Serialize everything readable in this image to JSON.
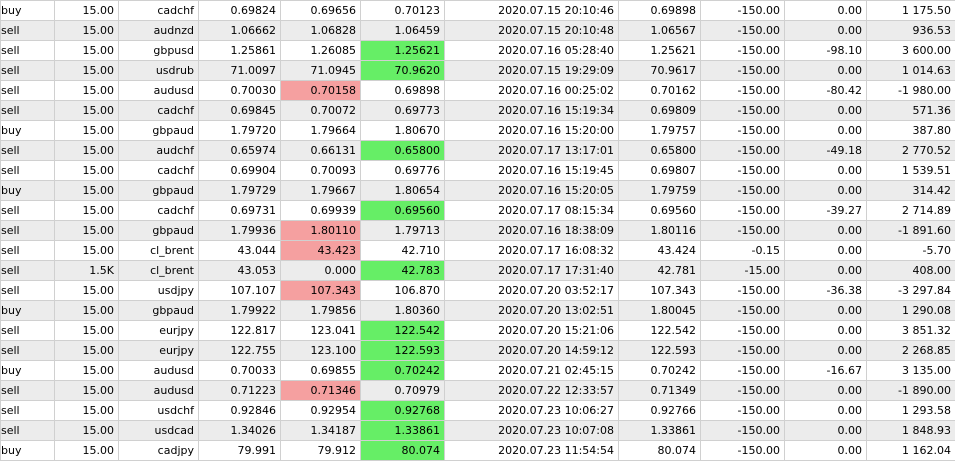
{
  "colors": {
    "tp_hit": "#66ee66",
    "sl_hit": "#f5a0a0",
    "row_alt": "#ececec"
  },
  "rows": [
    {
      "type": "buy",
      "volume": "15.00",
      "symbol": "cadchf",
      "open_price": "0.69824",
      "sl": "0.69656",
      "tp": "0.70123",
      "close_time": "2020.07.15 20:10:46",
      "close_price": "0.69898",
      "commission": "-150.00",
      "swap": "0.00",
      "profit": "1 175.50",
      "hit": ""
    },
    {
      "type": "sell",
      "volume": "15.00",
      "symbol": "audnzd",
      "open_price": "1.06662",
      "sl": "1.06828",
      "tp": "1.06459",
      "close_time": "2020.07.15 20:10:48",
      "close_price": "1.06567",
      "commission": "-150.00",
      "swap": "0.00",
      "profit": "936.53",
      "hit": ""
    },
    {
      "type": "sell",
      "volume": "15.00",
      "symbol": "gbpusd",
      "open_price": "1.25861",
      "sl": "1.26085",
      "tp": "1.25621",
      "close_time": "2020.07.16 05:28:40",
      "close_price": "1.25621",
      "commission": "-150.00",
      "swap": "-98.10",
      "profit": "3 600.00",
      "hit": "tp"
    },
    {
      "type": "sell",
      "volume": "15.00",
      "symbol": "usdrub",
      "open_price": "71.0097",
      "sl": "71.0945",
      "tp": "70.9620",
      "close_time": "2020.07.15 19:29:09",
      "close_price": "70.9617",
      "commission": "-150.00",
      "swap": "0.00",
      "profit": "1 014.63",
      "hit": "tp"
    },
    {
      "type": "sell",
      "volume": "15.00",
      "symbol": "audusd",
      "open_price": "0.70030",
      "sl": "0.70158",
      "tp": "0.69898",
      "close_time": "2020.07.16 00:25:02",
      "close_price": "0.70162",
      "commission": "-150.00",
      "swap": "-80.42",
      "profit": "-1 980.00",
      "hit": "sl"
    },
    {
      "type": "sell",
      "volume": "15.00",
      "symbol": "cadchf",
      "open_price": "0.69845",
      "sl": "0.70072",
      "tp": "0.69773",
      "close_time": "2020.07.16 15:19:34",
      "close_price": "0.69809",
      "commission": "-150.00",
      "swap": "0.00",
      "profit": "571.36",
      "hit": ""
    },
    {
      "type": "buy",
      "volume": "15.00",
      "symbol": "gbpaud",
      "open_price": "1.79720",
      "sl": "1.79664",
      "tp": "1.80670",
      "close_time": "2020.07.16 15:20:00",
      "close_price": "1.79757",
      "commission": "-150.00",
      "swap": "0.00",
      "profit": "387.80",
      "hit": ""
    },
    {
      "type": "sell",
      "volume": "15.00",
      "symbol": "audchf",
      "open_price": "0.65974",
      "sl": "0.66131",
      "tp": "0.65800",
      "close_time": "2020.07.17 13:17:01",
      "close_price": "0.65800",
      "commission": "-150.00",
      "swap": "-49.18",
      "profit": "2 770.52",
      "hit": "tp"
    },
    {
      "type": "sell",
      "volume": "15.00",
      "symbol": "cadchf",
      "open_price": "0.69904",
      "sl": "0.70093",
      "tp": "0.69776",
      "close_time": "2020.07.16 15:19:45",
      "close_price": "0.69807",
      "commission": "-150.00",
      "swap": "0.00",
      "profit": "1 539.51",
      "hit": ""
    },
    {
      "type": "buy",
      "volume": "15.00",
      "symbol": "gbpaud",
      "open_price": "1.79729",
      "sl": "1.79667",
      "tp": "1.80654",
      "close_time": "2020.07.16 15:20:05",
      "close_price": "1.79759",
      "commission": "-150.00",
      "swap": "0.00",
      "profit": "314.42",
      "hit": ""
    },
    {
      "type": "sell",
      "volume": "15.00",
      "symbol": "cadchf",
      "open_price": "0.69731",
      "sl": "0.69939",
      "tp": "0.69560",
      "close_time": "2020.07.17 08:15:34",
      "close_price": "0.69560",
      "commission": "-150.00",
      "swap": "-39.27",
      "profit": "2 714.89",
      "hit": "tp"
    },
    {
      "type": "sell",
      "volume": "15.00",
      "symbol": "gbpaud",
      "open_price": "1.79936",
      "sl": "1.80110",
      "tp": "1.79713",
      "close_time": "2020.07.16 18:38:09",
      "close_price": "1.80116",
      "commission": "-150.00",
      "swap": "0.00",
      "profit": "-1 891.60",
      "hit": "sl"
    },
    {
      "type": "sell",
      "volume": "15.00",
      "symbol": "cl_brent",
      "open_price": "43.044",
      "sl": "43.423",
      "tp": "42.710",
      "close_time": "2020.07.17 16:08:32",
      "close_price": "43.424",
      "commission": "-0.15",
      "swap": "0.00",
      "profit": "-5.70",
      "hit": "sl"
    },
    {
      "type": "sell",
      "volume": "1.5K",
      "symbol": "cl_brent",
      "open_price": "43.053",
      "sl": "0.000",
      "tp": "42.783",
      "close_time": "2020.07.17 17:31:40",
      "close_price": "42.781",
      "commission": "-15.00",
      "swap": "0.00",
      "profit": "408.00",
      "hit": "tp"
    },
    {
      "type": "sell",
      "volume": "15.00",
      "symbol": "usdjpy",
      "open_price": "107.107",
      "sl": "107.343",
      "tp": "106.870",
      "close_time": "2020.07.20 03:52:17",
      "close_price": "107.343",
      "commission": "-150.00",
      "swap": "-36.38",
      "profit": "-3 297.84",
      "hit": "sl"
    },
    {
      "type": "buy",
      "volume": "15.00",
      "symbol": "gbpaud",
      "open_price": "1.79922",
      "sl": "1.79856",
      "tp": "1.80360",
      "close_time": "2020.07.20 13:02:51",
      "close_price": "1.80045",
      "commission": "-150.00",
      "swap": "0.00",
      "profit": "1 290.08",
      "hit": ""
    },
    {
      "type": "sell",
      "volume": "15.00",
      "symbol": "eurjpy",
      "open_price": "122.817",
      "sl": "123.041",
      "tp": "122.542",
      "close_time": "2020.07.20 15:21:06",
      "close_price": "122.542",
      "commission": "-150.00",
      "swap": "0.00",
      "profit": "3 851.32",
      "hit": "tp"
    },
    {
      "type": "sell",
      "volume": "15.00",
      "symbol": "eurjpy",
      "open_price": "122.755",
      "sl": "123.100",
      "tp": "122.593",
      "close_time": "2020.07.20 14:59:12",
      "close_price": "122.593",
      "commission": "-150.00",
      "swap": "0.00",
      "profit": "2 268.85",
      "hit": "tp"
    },
    {
      "type": "buy",
      "volume": "15.00",
      "symbol": "audusd",
      "open_price": "0.70033",
      "sl": "0.69855",
      "tp": "0.70242",
      "close_time": "2020.07.21 02:45:15",
      "close_price": "0.70242",
      "commission": "-150.00",
      "swap": "-16.67",
      "profit": "3 135.00",
      "hit": "tp"
    },
    {
      "type": "sell",
      "volume": "15.00",
      "symbol": "audusd",
      "open_price": "0.71223",
      "sl": "0.71346",
      "tp": "0.70979",
      "close_time": "2020.07.22 12:33:57",
      "close_price": "0.71349",
      "commission": "-150.00",
      "swap": "0.00",
      "profit": "-1 890.00",
      "hit": "sl"
    },
    {
      "type": "sell",
      "volume": "15.00",
      "symbol": "usdchf",
      "open_price": "0.92846",
      "sl": "0.92954",
      "tp": "0.92768",
      "close_time": "2020.07.23 10:06:27",
      "close_price": "0.92766",
      "commission": "-150.00",
      "swap": "0.00",
      "profit": "1 293.58",
      "hit": "tp"
    },
    {
      "type": "sell",
      "volume": "15.00",
      "symbol": "usdcad",
      "open_price": "1.34026",
      "sl": "1.34187",
      "tp": "1.33861",
      "close_time": "2020.07.23 10:07:08",
      "close_price": "1.33861",
      "commission": "-150.00",
      "swap": "0.00",
      "profit": "1 848.93",
      "hit": "tp"
    },
    {
      "type": "buy",
      "volume": "15.00",
      "symbol": "cadjpy",
      "open_price": "79.991",
      "sl": "79.912",
      "tp": "80.074",
      "close_time": "2020.07.23 11:54:54",
      "close_price": "80.074",
      "commission": "-150.00",
      "swap": "0.00",
      "profit": "1 162.04",
      "hit": "tp"
    }
  ]
}
